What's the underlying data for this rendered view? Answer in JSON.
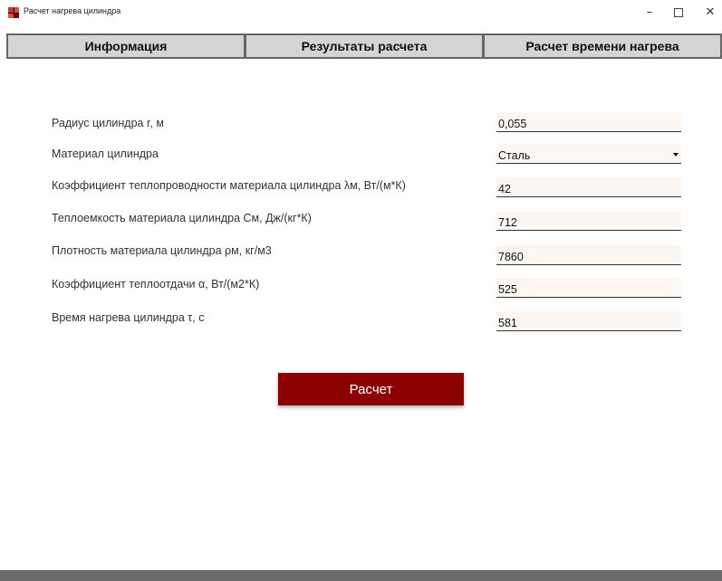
{
  "window": {
    "title": "Расчет нагрева цилиндра",
    "minimize_glyph": "–",
    "close_glyph": "✕"
  },
  "tabs": [
    {
      "label": "Информация"
    },
    {
      "label": "Результаты расчета"
    },
    {
      "label": "Расчет времени нагрева"
    }
  ],
  "form": {
    "rows": [
      {
        "label": "Радиус цилиндра r, м",
        "value": "0,055"
      },
      {
        "label": "Материал цилиндра",
        "value": "Сталь"
      },
      {
        "label": "Коэффициент теплопроводности материала цилиндра λм, Вт/(м*К)",
        "value": "42"
      },
      {
        "label": "Теплоемкость материала цилиндра См, Дж/(кг*К)",
        "value": "712"
      },
      {
        "label": "Плотность материала цилиндра ρм, кг/м3",
        "value": "7860"
      },
      {
        "label": "Коэффициент теплоотдачи α, Вт/(м2*К)",
        "value": "525"
      },
      {
        "label": "Время нагрева цилиндра τ, с",
        "value": "581"
      }
    ],
    "calculate_label": "Расчет"
  },
  "colors": {
    "accent": "#8b0000",
    "field_bg": "#fdf7f4",
    "tab_bg": "#d4d4d4"
  },
  "icons": {
    "app": "app-icon",
    "select": "chevron-down-icon"
  }
}
